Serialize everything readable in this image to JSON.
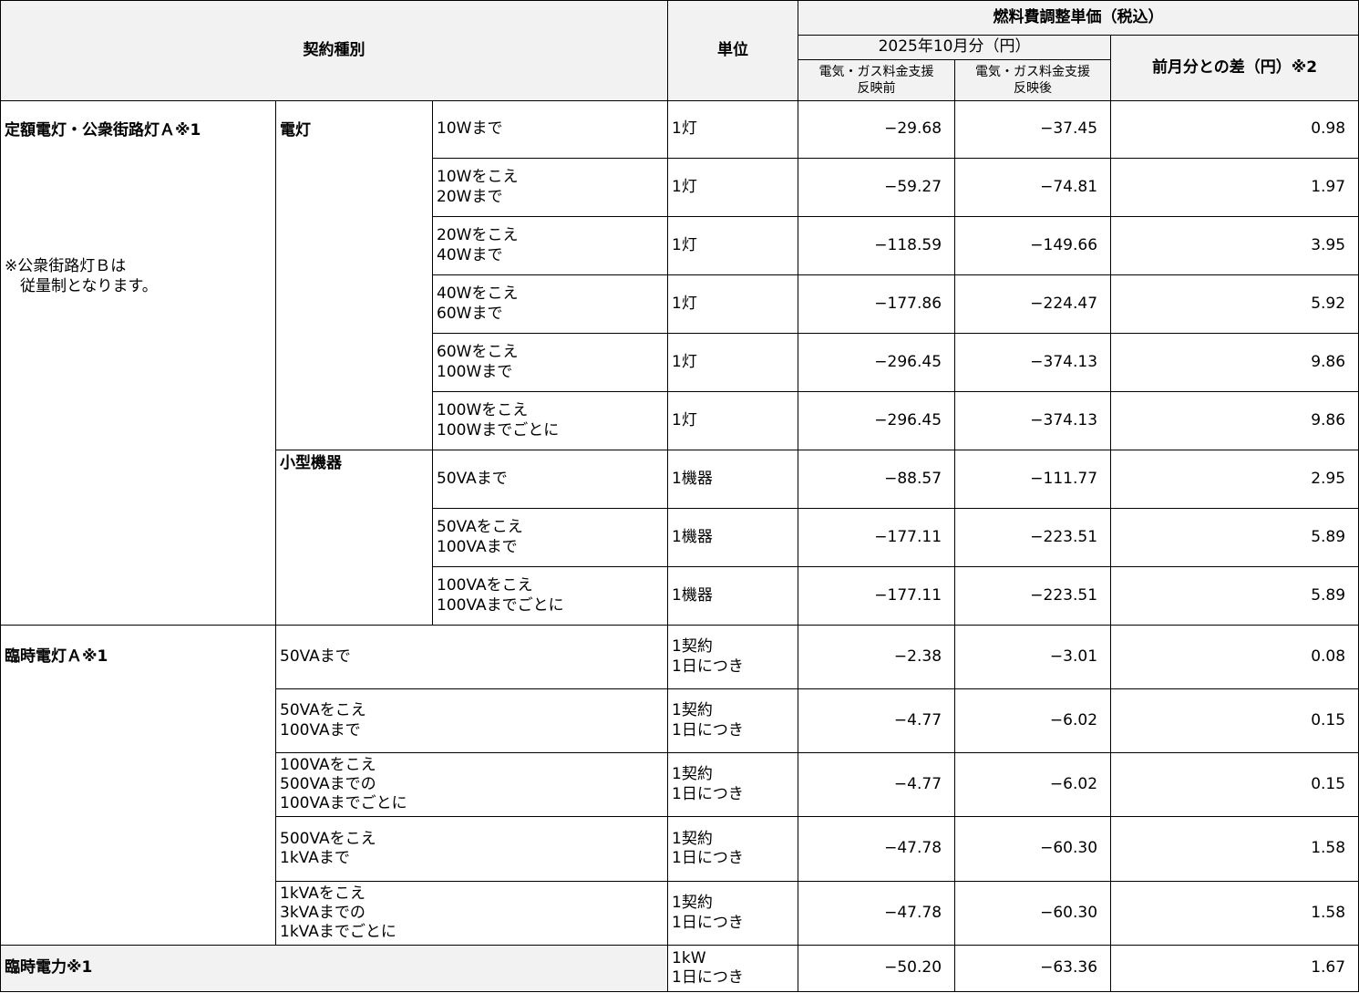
{
  "header": {
    "contract_type": "契約種別",
    "unit": "単位",
    "fuel_price": "燃料費調整単価（税込）",
    "period": "2025年10月分（円）",
    "before_support": "電気・ガス料金支援\n反映前",
    "after_support": "電気・ガス料金支援\n反映後",
    "diff": "前月分との差（円）※2"
  },
  "sections": {
    "flat": {
      "label": "定額電灯・公衆街路灯Ａ※1",
      "note": "※公衆街路灯Ｂは\n　従量制となります。",
      "lamp_label": "電灯",
      "small_device_label": "小型機器"
    },
    "temp_light": {
      "label": "臨時電灯Ａ※1"
    },
    "temp_power": {
      "label": "臨時電力※1"
    }
  },
  "rows": [
    {
      "range": "10Wまで",
      "unit": "1灯",
      "before": "−29.68",
      "after": "−37.45",
      "diff": "0.98"
    },
    {
      "range": "10Wをこえ\n20Wまで",
      "unit": "1灯",
      "before": "−59.27",
      "after": "−74.81",
      "diff": "1.97"
    },
    {
      "range": "20Wをこえ\n40Wまで",
      "unit": "1灯",
      "before": "−118.59",
      "after": "−149.66",
      "diff": "3.95"
    },
    {
      "range": "40Wをこえ\n60Wまで",
      "unit": "1灯",
      "before": "−177.86",
      "after": "−224.47",
      "diff": "5.92"
    },
    {
      "range": "60Wをこえ\n100Wまで",
      "unit": "1灯",
      "before": "−296.45",
      "after": "−374.13",
      "diff": "9.86"
    },
    {
      "range": "100Wをこえ\n100Wまでごとに",
      "unit": "1灯",
      "before": "−296.45",
      "after": "−374.13",
      "diff": "9.86"
    },
    {
      "range": "50VAまで",
      "unit": "1機器",
      "before": "−88.57",
      "after": "−111.77",
      "diff": "2.95"
    },
    {
      "range": "50VAをこえ\n100VAまで",
      "unit": "1機器",
      "before": "−177.11",
      "after": "−223.51",
      "diff": "5.89"
    },
    {
      "range": "100VAをこえ\n100VAまでごとに",
      "unit": "1機器",
      "before": "−177.11",
      "after": "−223.51",
      "diff": "5.89"
    },
    {
      "range": "50VAまで",
      "unit": "1契約\n1日につき",
      "before": "−2.38",
      "after": "−3.01",
      "diff": "0.08"
    },
    {
      "range": "50VAをこえ\n100VAまで",
      "unit": "1契約\n1日につき",
      "before": "−4.77",
      "after": "−6.02",
      "diff": "0.15"
    },
    {
      "range": "100VAをこえ\n500VAまでの\n100VAまでごとに",
      "unit": "1契約\n1日につき",
      "before": "−4.77",
      "after": "−6.02",
      "diff": "0.15"
    },
    {
      "range": "500VAをこえ\n1kVAまで",
      "unit": "1契約\n1日につき",
      "before": "−47.78",
      "after": "−60.30",
      "diff": "1.58"
    },
    {
      "range": "1kVAをこえ\n3kVAまでの\n1kVAまでごとに",
      "unit": "1契約\n1日につき",
      "before": "−47.78",
      "after": "−60.30",
      "diff": "1.58"
    },
    {
      "unit": "1kW\n1日につき",
      "before": "−50.20",
      "after": "−63.36",
      "diff": "1.67"
    }
  ]
}
